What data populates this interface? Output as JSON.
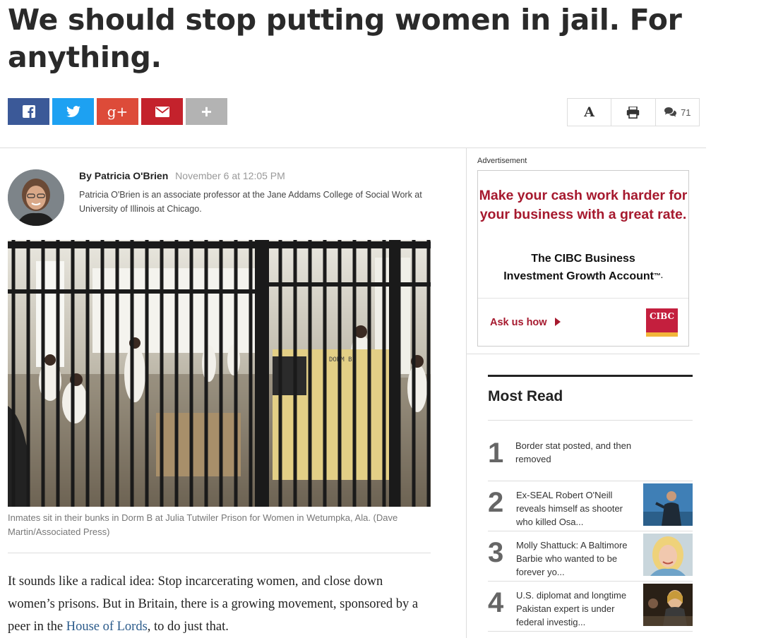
{
  "headline": "We should stop putting women in jail. For anything.",
  "share": {
    "facebook_icon": "facebook-icon",
    "twitter_icon": "twitter-icon",
    "googleplus_label": "g+",
    "email_icon": "email-icon",
    "more_label": "+"
  },
  "tools": {
    "font_label": "A",
    "print_icon": "print-icon",
    "comment_count": "71"
  },
  "byline": {
    "author": "By Patricia O'Brien",
    "date": "November 6 at 12:05 PM",
    "bio": "Patricia O'Brien is an associate professor at the Jane Addams College of Social Work at University of Illinois at Chicago."
  },
  "photo": {
    "sign": "DORM B",
    "caption": "Inmates sit in their bunks in Dorm B at Julia Tutwiler Prison for Women in Wetumpka, Ala. (Dave Martin/Associated Press)"
  },
  "body": {
    "p1_before": "It sounds like a radical idea: Stop incarcerating women, and close down women’s prisons. But in Britain, there is a growing movement, sponsored by a peer in the ",
    "p1_link": "House of Lords",
    "p1_after": ", to do just that."
  },
  "ad": {
    "label": "Advertisement",
    "headline": "Make your cash work harder for your business with a great rate.",
    "sub_line1": "The CIBC Business",
    "sub_line2": "Investment Growth Account",
    "sub_mark": "™.",
    "cta": "Ask us how",
    "logo": "CIBC"
  },
  "most_read": {
    "title": "Most Read",
    "items": [
      {
        "num": "1",
        "text": "Border stat posted, and then removed"
      },
      {
        "num": "2",
        "text": "Ex-SEAL Robert O'Neill reveals himself as shooter who killed Osa..."
      },
      {
        "num": "3",
        "text": "Molly Shattuck: A Baltimore Barbie who wanted to be forever yo..."
      },
      {
        "num": "4",
        "text": "U.S. diplomat and longtime Pakistan expert is under federal investig..."
      }
    ]
  },
  "colors": {
    "facebook": "#3b5998",
    "twitter": "#1da1f2",
    "googleplus": "#dd4b39",
    "email": "#c4222c",
    "ad_red": "#a6192e"
  }
}
